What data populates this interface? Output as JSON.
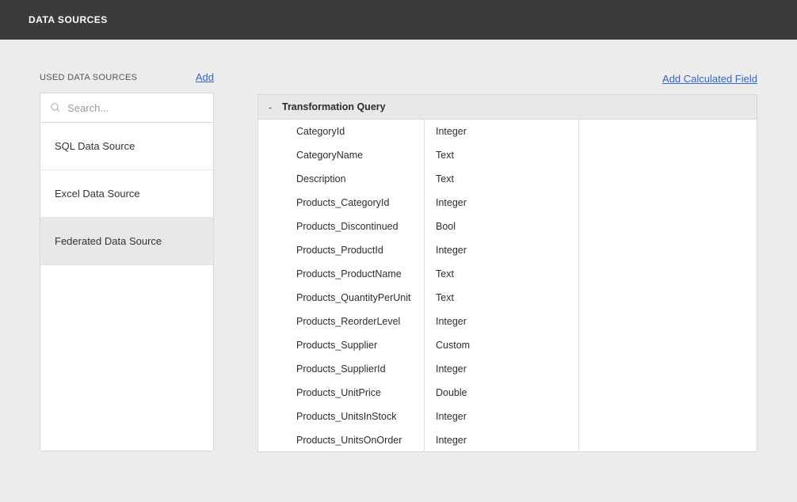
{
  "header": {
    "title": "DATA SOURCES"
  },
  "sidebar": {
    "title": "USED DATA SOURCES",
    "add_label": "Add",
    "search_placeholder": "Search...",
    "items": [
      {
        "label": "SQL Data Source",
        "selected": false
      },
      {
        "label": "Excel Data Source",
        "selected": false
      },
      {
        "label": "Federated Data Source",
        "selected": true
      }
    ]
  },
  "main": {
    "calc_field_label": "Add Calculated Field",
    "query_title": "Transformation Query",
    "collapse_symbol": "-",
    "fields": [
      {
        "name": "CategoryId",
        "type": "Integer"
      },
      {
        "name": "CategoryName",
        "type": "Text"
      },
      {
        "name": "Description",
        "type": "Text"
      },
      {
        "name": "Products_CategoryId",
        "type": "Integer"
      },
      {
        "name": "Products_Discontinued",
        "type": "Bool"
      },
      {
        "name": "Products_ProductId",
        "type": "Integer"
      },
      {
        "name": "Products_ProductName",
        "type": "Text"
      },
      {
        "name": "Products_QuantityPerUnit",
        "type": "Text"
      },
      {
        "name": "Products_ReorderLevel",
        "type": "Integer"
      },
      {
        "name": "Products_Supplier",
        "type": "Custom"
      },
      {
        "name": "Products_SupplierId",
        "type": "Integer"
      },
      {
        "name": "Products_UnitPrice",
        "type": "Double"
      },
      {
        "name": "Products_UnitsInStock",
        "type": "Integer"
      },
      {
        "name": "Products_UnitsOnOrder",
        "type": "Integer"
      }
    ]
  }
}
